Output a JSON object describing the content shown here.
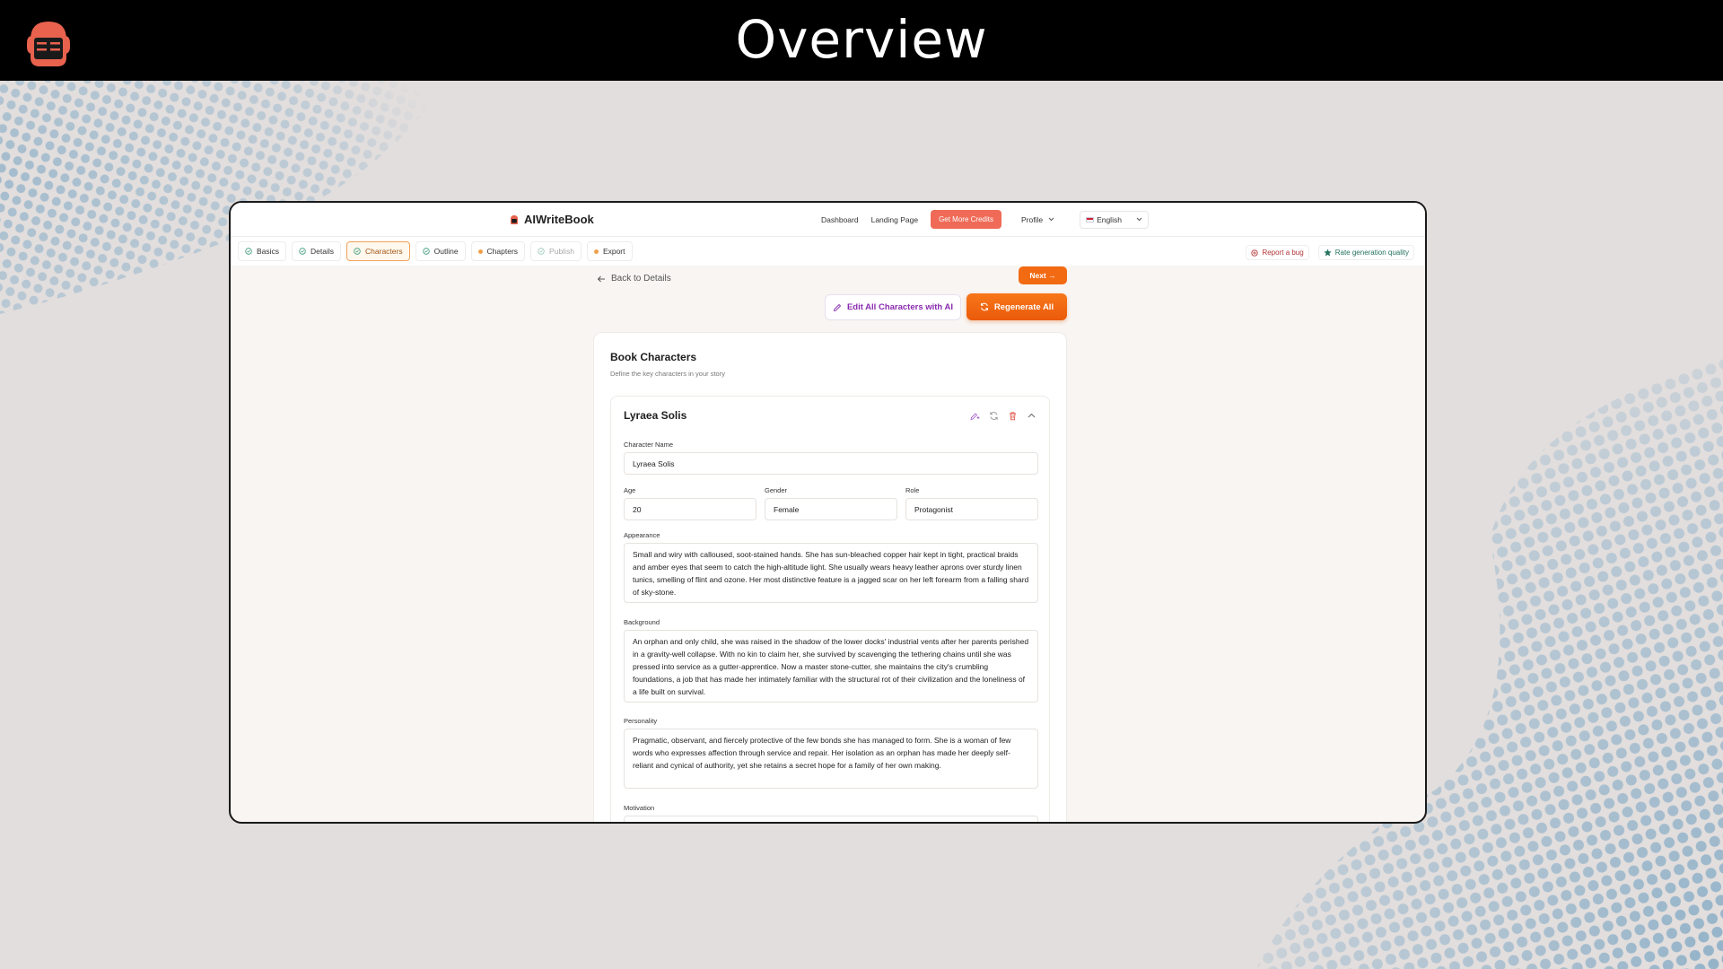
{
  "banner": {
    "title": "Overview",
    "logo": "book-reader-logo"
  },
  "app": {
    "brand": "AIWriteBook",
    "nav": {
      "dashboard": "Dashboard",
      "landing": "Landing Page",
      "credits_button": "Get More Credits",
      "profile": "Profile",
      "language": "English"
    },
    "steps": [
      {
        "label": "Basics",
        "state": "done"
      },
      {
        "label": "Details",
        "state": "done"
      },
      {
        "label": "Characters",
        "state": "active"
      },
      {
        "label": "Outline",
        "state": "done"
      },
      {
        "label": "Chapters",
        "state": "pending"
      },
      {
        "label": "Publish",
        "state": "disabled"
      },
      {
        "label": "Export",
        "state": "pending"
      }
    ],
    "utils": {
      "report_bug": "Report a bug",
      "rate_quality": "Rate generation quality"
    },
    "back_link": "Back to Details",
    "next_button": "Next →",
    "edit_ai_button": "Edit All Characters with AI",
    "regenerate_button": "Regenerate All",
    "colors": {
      "accent": "#f26a12",
      "credits": "#ef6b57",
      "ai_purple": "#8a2bb0"
    }
  },
  "characters_card": {
    "title": "Book Characters",
    "subtitle": "Define the key characters in your story",
    "character": {
      "name": "Lyraea Solis",
      "labels": {
        "name": "Character Name",
        "age": "Age",
        "gender": "Gender",
        "role": "Role",
        "appearance": "Appearance",
        "background": "Background",
        "personality": "Personality",
        "motivation": "Motivation"
      },
      "values": {
        "name": "Lyraea Solis",
        "age": "20",
        "gender": "Female",
        "role": "Protagonist",
        "appearance": "Small and wiry with calloused, soot-stained hands. She has sun-bleached copper hair kept in tight, practical braids and amber eyes that seem to catch the high-altitude light. She usually wears heavy leather aprons over sturdy linen tunics, smelling of flint and ozone. Her most distinctive feature is a jagged scar on her left forearm from a falling shard of sky-stone.",
        "background": "An orphan and only child, she was raised in the shadow of the lower docks' industrial vents after her parents perished in a gravity-well collapse. With no kin to claim her, she survived by scavenging the tethering chains until she was pressed into service as a gutter-apprentice. Now a master stone-cutter, she maintains the city's crumbling foundations, a job that has made her intimately familiar with the structural rot of their civilization and the loneliness of a life built on survival.",
        "personality": "Pragmatic, observant, and fiercely protective of the few bonds she has managed to form. She is a woman of few words who expresses affection through service and repair. Her isolation as an orphan has made her deeply self-reliant and cynical of authority, yet she retains a secret hope for a family of her own making.",
        "motivation": ""
      }
    }
  }
}
